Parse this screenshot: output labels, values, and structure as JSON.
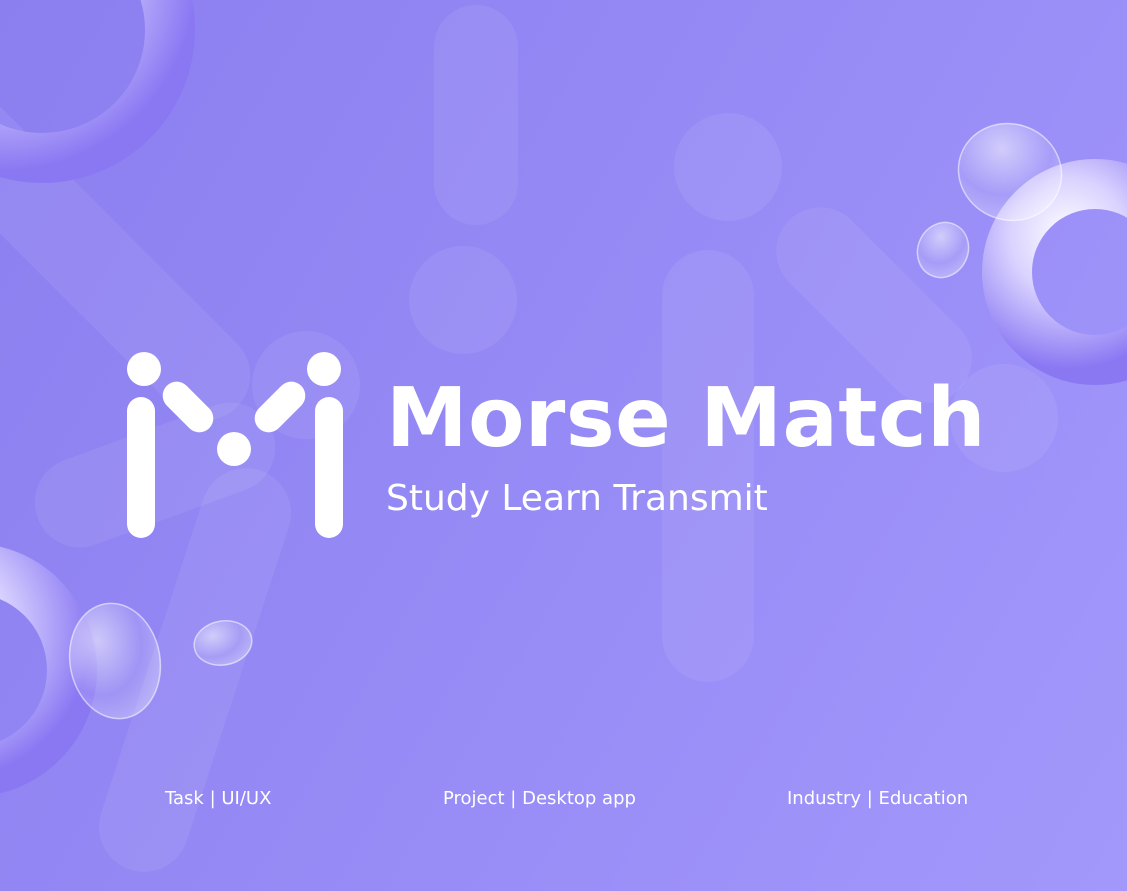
{
  "brand": {
    "title": "Morse Match",
    "tagline": "Study Learn Transmit",
    "logo_icon": "morse-m-logo-icon"
  },
  "info": {
    "task": "Task | UI/UX",
    "project": "Project | Desktop app",
    "industry": "Industry | Education"
  },
  "colors": {
    "background_start": "#8b7ff0",
    "background_end": "#a298fb",
    "text": "#ffffff",
    "ring": "#8f7ef5"
  }
}
